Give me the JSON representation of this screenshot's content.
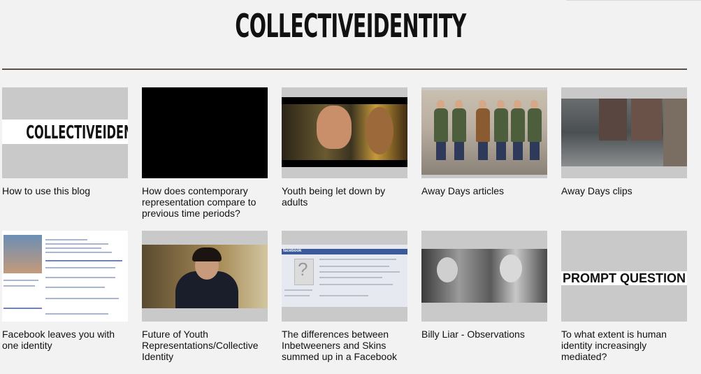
{
  "site": {
    "title": "COLLECTIVEIDENTITY"
  },
  "posts": [
    {
      "title": "How to use this blog",
      "thumb": "collectiveidentity-logo",
      "thumb_text": "COLLECTIVEIDENTITY"
    },
    {
      "title": "How does contemporary representation compare to previous time periods?",
      "thumb": "black-video"
    },
    {
      "title": "Youth being let down by adults",
      "thumb": "film-still-two-faces"
    },
    {
      "title": "Away Days articles",
      "thumb": "group-of-young-men-photo"
    },
    {
      "title": "Away Days clips",
      "thumb": "street-scene-still"
    },
    {
      "title": "Facebook leaves you with one identity",
      "thumb": "facebook-profile-screenshot"
    },
    {
      "title": "Future of Youth Representations/Collective Identity",
      "thumb": "boy-in-coat-still"
    },
    {
      "title": "The differences between Inbetweeners and Skins summed up in a Facebook",
      "thumb": "facebook-page-screenshot",
      "thumb_text": "facebook"
    },
    {
      "title": "Billy Liar - Observations",
      "thumb": "black-and-white-film-still"
    },
    {
      "title": "To what extent is human identity increasingly mediated?",
      "thumb": "prompt-question-card",
      "thumb_text": "PROMPT QUESTION"
    }
  ],
  "colors": {
    "background": "#f2f2f2",
    "header_rule": "#5b4f48",
    "thumb_placeholder": "#c9c9c9",
    "facebook_blue": "#3b5998"
  }
}
